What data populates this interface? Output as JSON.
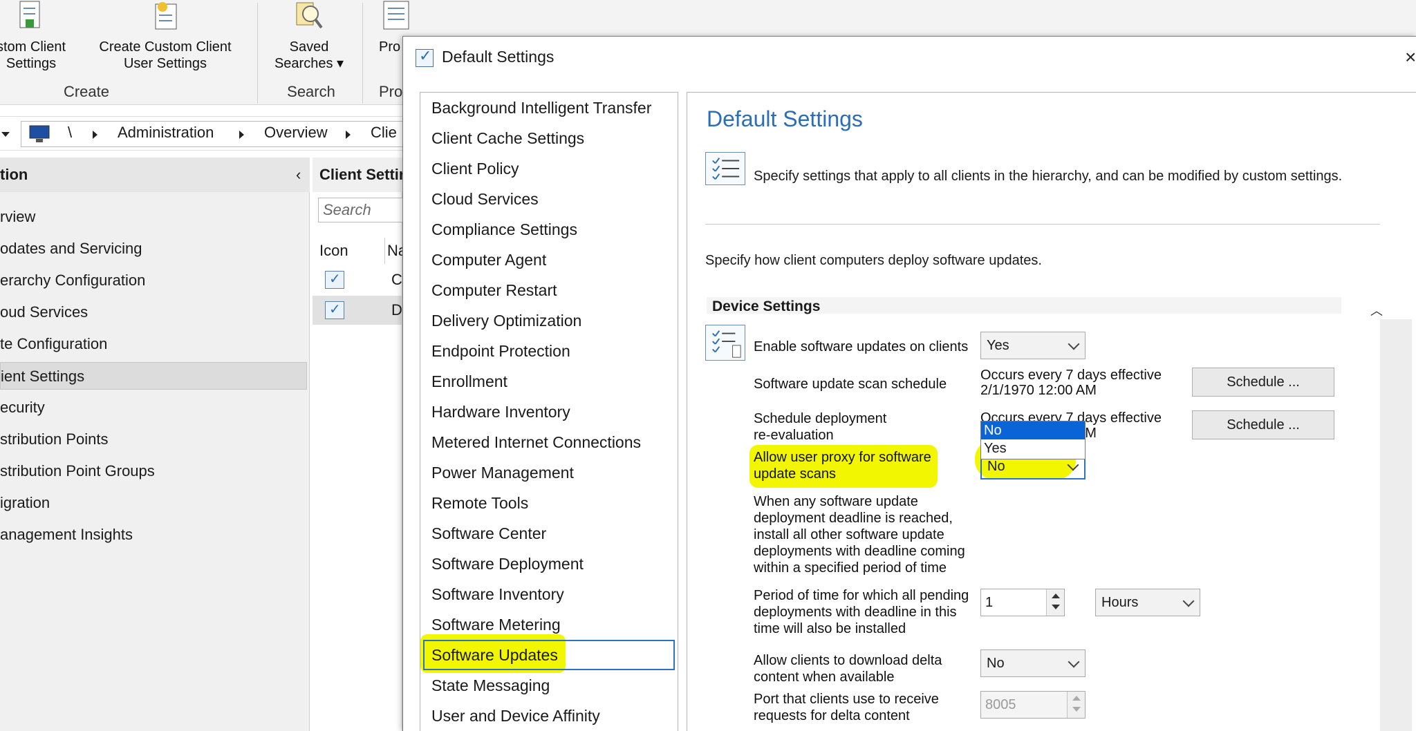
{
  "ribbon": {
    "buttons": [
      {
        "label": "stom Client\nSettings",
        "icon": "client-settings-icon"
      },
      {
        "label": "Create Custom Client\nUser Settings",
        "icon": "user-settings-icon"
      },
      {
        "label": "Saved\nSearches ▾",
        "icon": "saved-searches-icon"
      },
      {
        "label": "Pro",
        "icon": "properties-icon"
      }
    ],
    "groups": {
      "create": "Create",
      "search": "Search",
      "properties": "Pro"
    }
  },
  "breadcrumb": {
    "items": [
      "\\",
      "Administration",
      "Overview",
      "Clie"
    ]
  },
  "navigation": {
    "header": "tion",
    "items": [
      {
        "label": "rview"
      },
      {
        "label": "odates and Servicing"
      },
      {
        "label": "erarchy Configuration"
      },
      {
        "label": "oud Services"
      },
      {
        "label": "te Configuration"
      },
      {
        "label": "ient Settings",
        "selected": true
      },
      {
        "label": "ecurity"
      },
      {
        "label": "stribution Points"
      },
      {
        "label": "stribution Point Groups"
      },
      {
        "label": "igration"
      },
      {
        "label": "anagement Insights"
      }
    ]
  },
  "list": {
    "title": "Client Settir",
    "search_placeholder": "Search",
    "columns": [
      "Icon",
      "Na"
    ],
    "rows": [
      {
        "name": "C"
      },
      {
        "name": "D",
        "selected": true
      }
    ]
  },
  "dialog": {
    "title": "Default Settings",
    "close": "×",
    "categories": [
      "Background Intelligent Transfer",
      "Client Cache Settings",
      "Client Policy",
      "Cloud Services",
      "Compliance Settings",
      "Computer Agent",
      "Computer Restart",
      "Delivery Optimization",
      "Endpoint Protection",
      "Enrollment",
      "Hardware Inventory",
      "Metered Internet Connections",
      "Power Management",
      "Remote Tools",
      "Software Center",
      "Software Deployment",
      "Software Inventory",
      "Software Metering",
      "Software Updates",
      "State Messaging",
      "User and Device Affinity"
    ],
    "selected_category": "Software Updates",
    "page_title": "Default Settings",
    "description": "Specify settings that apply to all clients in the hierarchy, and can be modified by custom settings.",
    "sub_description": "Specify how client computers deploy software updates.",
    "section_title": "Device Settings",
    "settings": {
      "enable_updates": {
        "label": "Enable software updates on clients",
        "value": "Yes"
      },
      "scan_schedule": {
        "label": "Software update scan schedule",
        "value": "Occurs every 7 days effective\n2/1/1970 12:00 AM",
        "button": "Schedule ..."
      },
      "reevaluation": {
        "label": "Schedule deployment\nre-evaluation",
        "value": "Occurs every 7 days effective\n2/1/1970 12:00 AM",
        "button": "Schedule ..."
      },
      "user_proxy": {
        "label": "Allow user proxy for software\nupdate scans",
        "value": "No",
        "options": [
          "No",
          "Yes"
        ]
      },
      "deadline": {
        "label": "When any software update\ndeployment deadline is reached,\ninstall all other software update\ndeployments with deadline coming\nwithin a specified period of time"
      },
      "period": {
        "label": "Period of time for which all pending\ndeployments with deadline in this\ntime will also be installed",
        "value": "1",
        "unit": "Hours"
      },
      "delta": {
        "label": "Allow clients to download delta\ncontent when available",
        "value": "No"
      },
      "port": {
        "label": "Port that clients use to receive\nrequests for delta content",
        "value": "8005"
      }
    }
  },
  "colors": {
    "highlight": "#f2f700",
    "accent": "#2a6eb8",
    "selection": "#0a64d8"
  }
}
